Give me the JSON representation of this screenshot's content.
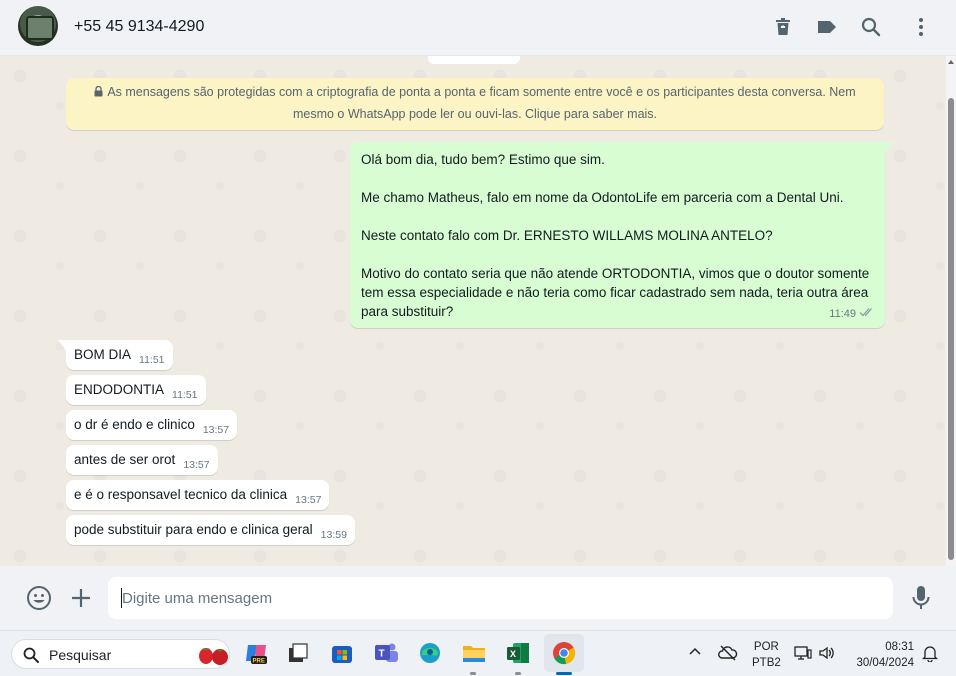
{
  "header": {
    "contact_name": "+55 45 9134-4290",
    "icons": [
      "delete-icon",
      "label-icon",
      "search-icon",
      "more-vertical-icon"
    ]
  },
  "encryption_notice": {
    "text": "As mensagens são protegidas com a criptografia de ponta a ponta e ficam somente entre você e os participantes desta conversa. Nem mesmo o WhatsApp pode ler ou ouvi-las. Clique para saber mais."
  },
  "outgoing_message": {
    "text": "Olá bom dia, tudo bem? Estimo que sim.\n\nMe chamo Matheus, falo em nome da OdontoLife em parceria com a Dental Uni.\n\nNeste contato falo com Dr. ERNESTO WILLAMS MOLINA ANTELO?\n\nMotivo do contato seria que não atende ORTODONTIA, vimos que o doutor somente tem essa especialidade e não teria como ficar cadastrado sem nada, teria outra área para substituir?",
    "time": "11:49",
    "status": "delivered"
  },
  "incoming_messages": [
    {
      "text": "BOM DIA",
      "time": "11:51"
    },
    {
      "text": "ENDODONTIA",
      "time": "11:51"
    },
    {
      "text": "o dr é endo e clinico",
      "time": "13:57"
    },
    {
      "text": "antes de ser orot",
      "time": "13:57"
    },
    {
      "text": "e é o responsavel tecnico da clinica",
      "time": "13:57"
    },
    {
      "text": "pode substituir para endo e clinica geral",
      "time": "13:59"
    }
  ],
  "composer": {
    "placeholder": "Digite uma mensagem",
    "value": ""
  },
  "taskbar": {
    "search_label": "Pesquisar",
    "language": "POR",
    "keyboard_layout": "PTB2",
    "time": "08:31",
    "date": "30/04/2024",
    "apps": [
      "copilot-icon",
      "task-view-icon",
      "microsoft-store-icon",
      "teams-icon",
      "edge-icon",
      "file-explorer-icon",
      "excel-icon",
      "chrome-icon"
    ]
  },
  "colors": {
    "outgoing_bubble": "#d9fdd3",
    "incoming_bubble": "#ffffff",
    "encryption_notice_bg": "#fdf4c5",
    "chat_background": "#efeae2",
    "header_bg": "#f0f2f5"
  }
}
